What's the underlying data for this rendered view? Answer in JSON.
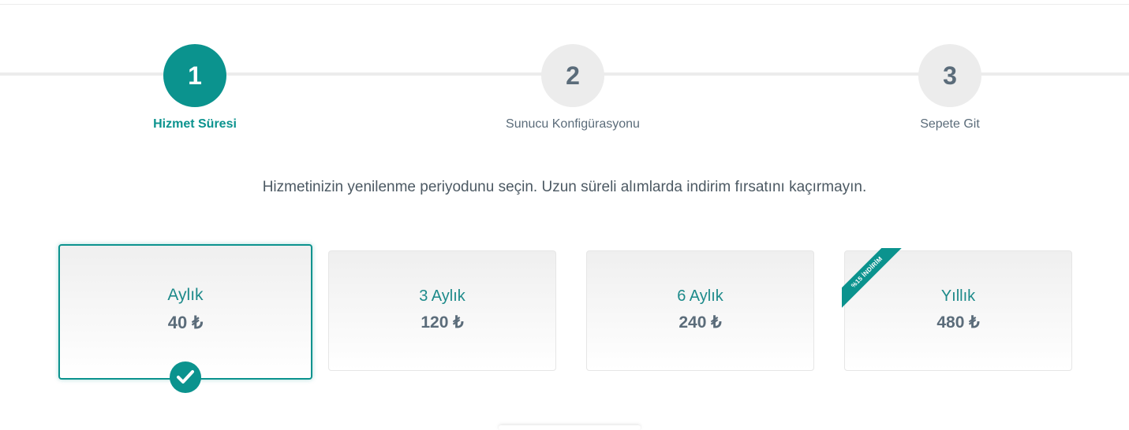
{
  "steps": [
    {
      "number": "1",
      "label": "Hizmet Süresi",
      "active": true
    },
    {
      "number": "2",
      "label": "Sunucu Konfigürasyonu",
      "active": false
    },
    {
      "number": "3",
      "label": "Sepete Git",
      "active": false
    }
  ],
  "intro": "Hizmetinizin yenilenme periyodunu seçin. Uzun süreli alımlarda indirim fırsatını kaçırmayın.",
  "plans": [
    {
      "period": "Aylık",
      "price": "40 ₺",
      "selected": true
    },
    {
      "period": "3 Aylık",
      "price": "120 ₺",
      "selected": false
    },
    {
      "period": "6 Aylık",
      "price": "240 ₺",
      "selected": false
    },
    {
      "period": "Yıllık",
      "price": "480 ₺",
      "selected": false,
      "ribbon": "%15 İNDİRİM"
    }
  ],
  "colors": {
    "accent": "#0b938e",
    "muted": "#5b6c7a",
    "track": "#ececec"
  },
  "icons": {
    "selected_check": "check-circle-icon"
  }
}
